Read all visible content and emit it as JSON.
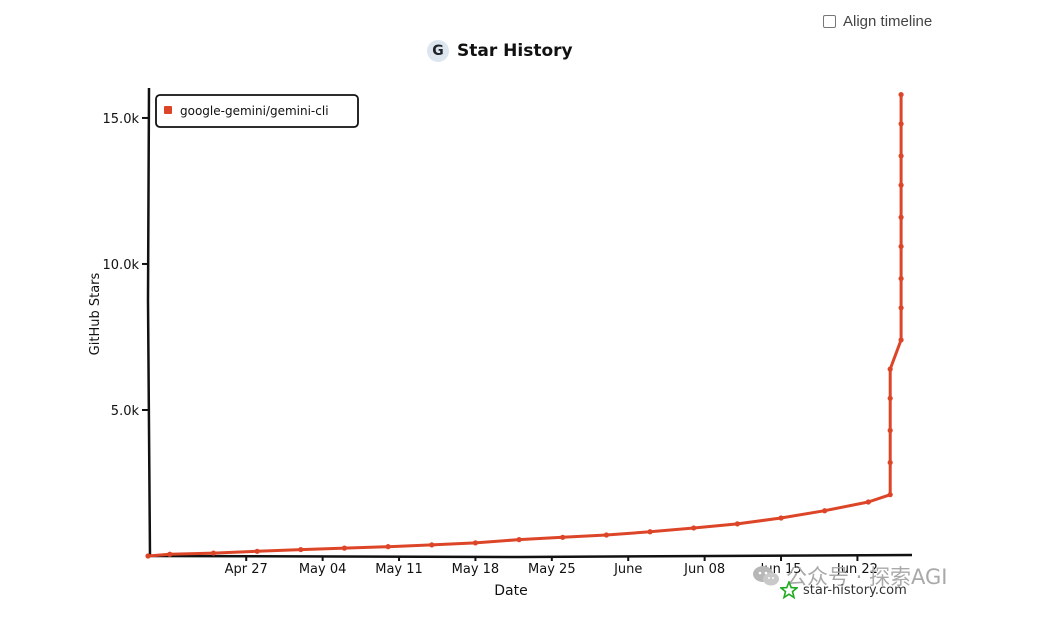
{
  "controls": {
    "align_timeline_label": "Align timeline",
    "align_timeline_checked": false
  },
  "header": {
    "logo_letter": "G",
    "title": "Star History"
  },
  "watermark": {
    "text": "公众号 · 探索AGI",
    "icon": "wechat-icon"
  },
  "credit": {
    "text": "star-history.com",
    "icon": "star-outline-icon"
  },
  "colors": {
    "series": "#dd4528",
    "axis": "#111111"
  },
  "chart_data": {
    "type": "line",
    "title": "Star History",
    "xlabel": "Date",
    "ylabel": "GitHub Stars",
    "x_tick_labels": [
      "Apr 27",
      "May 04",
      "May 11",
      "May 18",
      "May 25",
      "June",
      "Jun 08",
      "Jun 15",
      "Jun 22"
    ],
    "y_tick_labels": [
      "5.0k",
      "10.0k",
      "15.0k"
    ],
    "y_ticks": [
      5000,
      10000,
      15000
    ],
    "ylim": [
      0,
      16300
    ],
    "xlim": [
      "2025-04-18",
      "2025-06-27"
    ],
    "legend": {
      "position": "top-left",
      "entries": [
        "google-gemini/gemini-cli"
      ]
    },
    "grid": false,
    "series": [
      {
        "name": "google-gemini/gemini-cli",
        "points": [
          {
            "date": "2025-04-18",
            "stars": 0
          },
          {
            "date": "2025-04-20",
            "stars": 60
          },
          {
            "date": "2025-04-24",
            "stars": 100
          },
          {
            "date": "2025-04-28",
            "stars": 160
          },
          {
            "date": "2025-05-02",
            "stars": 220
          },
          {
            "date": "2025-05-06",
            "stars": 270
          },
          {
            "date": "2025-05-10",
            "stars": 320
          },
          {
            "date": "2025-05-14",
            "stars": 380
          },
          {
            "date": "2025-05-18",
            "stars": 450
          },
          {
            "date": "2025-05-22",
            "stars": 560
          },
          {
            "date": "2025-05-26",
            "stars": 640
          },
          {
            "date": "2025-05-30",
            "stars": 720
          },
          {
            "date": "2025-06-03",
            "stars": 830
          },
          {
            "date": "2025-06-07",
            "stars": 960
          },
          {
            "date": "2025-06-11",
            "stars": 1100
          },
          {
            "date": "2025-06-15",
            "stars": 1300
          },
          {
            "date": "2025-06-19",
            "stars": 1550
          },
          {
            "date": "2025-06-23",
            "stars": 1850
          },
          {
            "date": "2025-06-25",
            "stars": 2100
          },
          {
            "date": "2025-06-25",
            "stars": 3200
          },
          {
            "date": "2025-06-25",
            "stars": 4300
          },
          {
            "date": "2025-06-25",
            "stars": 5400
          },
          {
            "date": "2025-06-25",
            "stars": 6400
          },
          {
            "date": "2025-06-26",
            "stars": 7400
          },
          {
            "date": "2025-06-26",
            "stars": 8500
          },
          {
            "date": "2025-06-26",
            "stars": 9500
          },
          {
            "date": "2025-06-26",
            "stars": 10600
          },
          {
            "date": "2025-06-26",
            "stars": 11600
          },
          {
            "date": "2025-06-26",
            "stars": 12700
          },
          {
            "date": "2025-06-26",
            "stars": 13700
          },
          {
            "date": "2025-06-26",
            "stars": 14800
          },
          {
            "date": "2025-06-26",
            "stars": 15800
          }
        ]
      }
    ]
  }
}
